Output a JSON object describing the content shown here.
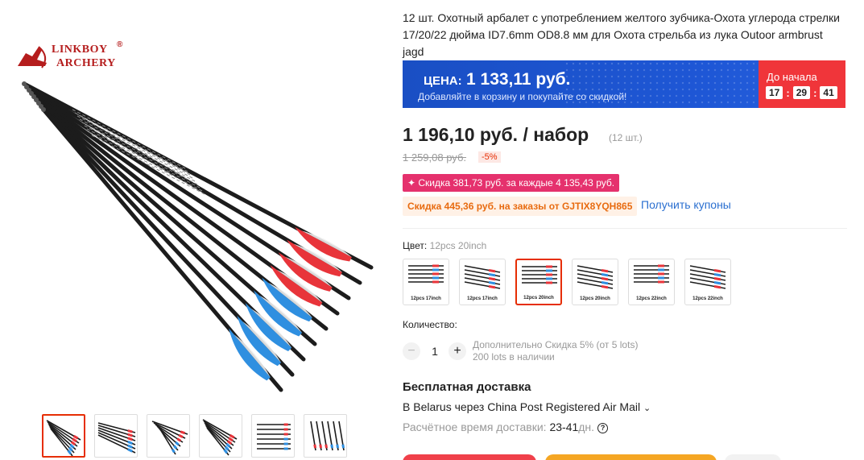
{
  "brand": {
    "logo_line1": "LINKBOY",
    "logo_line2": "ARCHERY",
    "logo_reg": "®"
  },
  "product": {
    "title": "12 шт. Охотный арбалет с употреблением желтого зубчика-Охота углерода стрелки 17/20/22 дюйма ID7.6mm OD8.8 мм для Охота стрельба из лука Outoor armbrust jagd"
  },
  "promo_banner": {
    "label": "ЦЕНА:",
    "price": "1 133,11 руб.",
    "subtitle": "Добавляйте в корзину и покупайте со скидкой!",
    "countdown_label": "До начала",
    "hours": "17",
    "minutes": "29",
    "seconds": "41",
    "colors": {
      "banner": "#1e57d6",
      "countdown": "#f0353a"
    }
  },
  "pricing": {
    "price": "1 196,10 руб. / набор",
    "unit_count": "(12 шт.)",
    "old_price": "1 259,08 руб.",
    "discount_percent": "-5%"
  },
  "discounts": {
    "store_discount": "✦ Скидка 381,73 руб. за каждые 4 135,43 руб.",
    "coupon_discount": "Скидка 445,36 руб. на заказы от GJTIX8YQH865",
    "get_coupons": "Получить купоны"
  },
  "color": {
    "label": "Цвет:",
    "selected": "12pcs 20inch",
    "variants": [
      {
        "caption": "12pcs 17inch",
        "selected": false
      },
      {
        "caption": "12pcs 17inch",
        "selected": false
      },
      {
        "caption": "12pcs 20inch",
        "selected": true
      },
      {
        "caption": "12pcs 20inch",
        "selected": false
      },
      {
        "caption": "12pcs 22inch",
        "selected": false
      },
      {
        "caption": "12pcs 22inch",
        "selected": false
      }
    ]
  },
  "quantity": {
    "label": "Количество:",
    "minus": "−",
    "value": "1",
    "plus": "+",
    "bulk_info": "Дополнительно Скидка 5% (от 5 lots)",
    "stock": "200 lots в наличии"
  },
  "shipping": {
    "title": "Бесплатная доставка",
    "destination": "В Belarus через China Post Registered Air Mail",
    "chevron": "⌄",
    "time_label": "Расчётное время доставки:",
    "time_value": "23-41",
    "time_unit": "дн.",
    "help": "?"
  },
  "gallery": {
    "thumb_count": 6,
    "active_index": 0
  },
  "accent_color": "#e62e04"
}
